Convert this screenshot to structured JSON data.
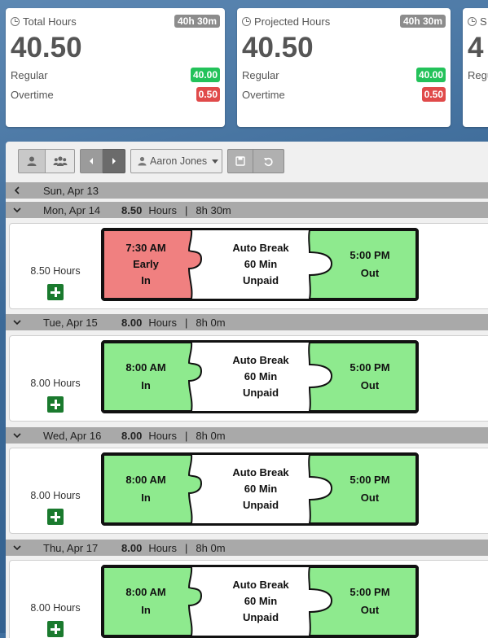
{
  "summary_cards": [
    {
      "title": "Total Hours",
      "badge": "40h 30m",
      "value": "40.50",
      "regular_label": "Regular",
      "regular_value": "40.00",
      "overtime_label": "Overtime",
      "overtime_value": "0.50"
    },
    {
      "title": "Projected Hours",
      "badge": "40h 30m",
      "value": "40.50",
      "regular_label": "Regular",
      "regular_value": "40.00",
      "overtime_label": "Overtime",
      "overtime_value": "0.50"
    },
    {
      "title": "S",
      "value": "4",
      "regular_label": "Regu"
    }
  ],
  "toolbar": {
    "employee_name": "Aaron Jones"
  },
  "colors": {
    "in_early": "#f08080",
    "punch_green": "#8eea8e",
    "break": "#ffffff",
    "add_button": "#1a7a2e"
  },
  "days": [
    {
      "date": "Sun, Apr 13",
      "collapsed": true
    },
    {
      "date": "Mon, Apr 14",
      "hours": "8.50",
      "hours_label": "Hours",
      "separator": "|",
      "duration": "8h 30m",
      "total_label": "8.50 Hours",
      "in_time": "7:30 AM",
      "in_note": "Early",
      "in_label": "In",
      "break_line1": "Auto Break",
      "break_line2": "60 Min",
      "break_line3": "Unpaid",
      "out_time": "5:00 PM",
      "out_label": "Out",
      "in_status": "early"
    },
    {
      "date": "Tue, Apr 15",
      "hours": "8.00",
      "hours_label": "Hours",
      "separator": "|",
      "duration": "8h 0m",
      "total_label": "8.00 Hours",
      "in_time": "8:00 AM",
      "in_note": "",
      "in_label": "In",
      "break_line1": "Auto Break",
      "break_line2": "60 Min",
      "break_line3": "Unpaid",
      "out_time": "5:00 PM",
      "out_label": "Out",
      "in_status": "normal"
    },
    {
      "date": "Wed, Apr 16",
      "hours": "8.00",
      "hours_label": "Hours",
      "separator": "|",
      "duration": "8h 0m",
      "total_label": "8.00 Hours",
      "in_time": "8:00 AM",
      "in_note": "",
      "in_label": "In",
      "break_line1": "Auto Break",
      "break_line2": "60 Min",
      "break_line3": "Unpaid",
      "out_time": "5:00 PM",
      "out_label": "Out",
      "in_status": "normal"
    },
    {
      "date": "Thu, Apr 17",
      "hours": "8.00",
      "hours_label": "Hours",
      "separator": "|",
      "duration": "8h 0m",
      "total_label": "8.00 Hours",
      "in_time": "8:00 AM",
      "in_note": "",
      "in_label": "In",
      "break_line1": "Auto Break",
      "break_line2": "60 Min",
      "break_line3": "Unpaid",
      "out_time": "5:00 PM",
      "out_label": "Out",
      "in_status": "normal"
    }
  ]
}
